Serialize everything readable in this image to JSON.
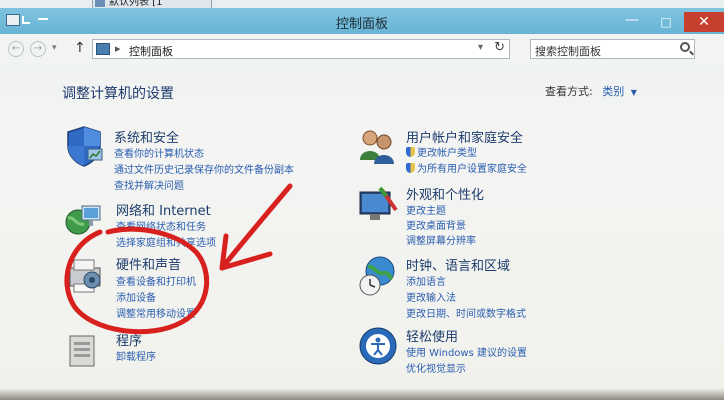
{
  "taskbar_tab": {
    "label": "默认列表 [1"
  },
  "window": {
    "title": "控制面板",
    "controls": {
      "minimize": "—",
      "maximize": "□",
      "close": "✕"
    }
  },
  "address": {
    "path": "控制面板",
    "separator": "▸",
    "search_placeholder": "搜索控制面板"
  },
  "main": {
    "heading": "调整计算机的设置",
    "view_by_label": "查看方式:",
    "view_by_value": "类别"
  },
  "categories": [
    {
      "title": "系统和安全",
      "icon": "shield-icon",
      "links": [
        "查看你的计算机状态",
        "通过文件历史记录保存你的文件备份副本",
        "查找并解决问题"
      ]
    },
    {
      "title": "网络和 Internet",
      "icon": "network-globe-icon",
      "links": [
        "查看网络状态和任务",
        "选择家庭组和共享选项"
      ]
    },
    {
      "title": "硬件和声音",
      "icon": "printer-speaker-icon",
      "links": [
        "查看设备和打印机",
        "添加设备",
        "调整常用移动设置"
      ]
    },
    {
      "title": "程序",
      "icon": "programs-icon",
      "links": [
        "卸载程序"
      ]
    },
    {
      "title": "用户帐户和家庭安全",
      "icon": "users-icon",
      "links": [
        "更改帐户类型",
        "为所有用户设置家庭安全"
      ]
    },
    {
      "title": "外观和个性化",
      "icon": "monitor-brush-icon",
      "links": [
        "更改主题",
        "更改桌面背景",
        "调整屏幕分辨率"
      ]
    },
    {
      "title": "时钟、语言和区域",
      "icon": "clock-globe-icon",
      "links": [
        "添加语言",
        "更改输入法",
        "更改日期、时间或数字格式"
      ]
    },
    {
      "title": "轻松使用",
      "icon": "ease-of-access-icon",
      "links": [
        "使用 Windows 建议的设置",
        "优化视觉显示"
      ]
    }
  ],
  "colors": {
    "title_bar": "#6fb9d8",
    "link": "#2a5db0",
    "heading": "#1e3a6e",
    "ink_annotation": "#d8201e",
    "close_button": "#c7402f"
  }
}
